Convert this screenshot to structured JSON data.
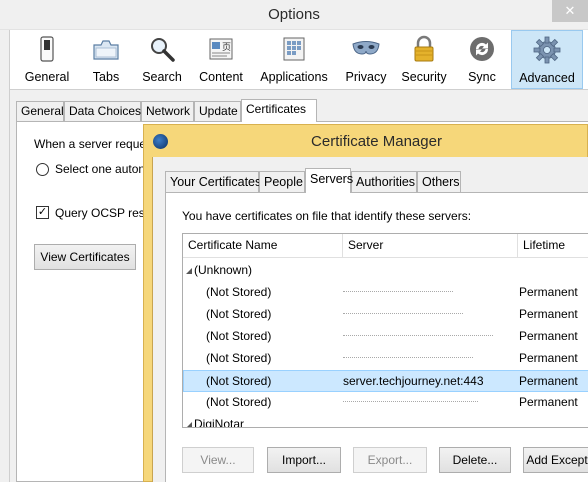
{
  "options_window": {
    "title": "Options",
    "close_symbol": "✕",
    "toolbar": [
      {
        "label": "General",
        "icon": "switch-icon"
      },
      {
        "label": "Tabs",
        "icon": "tabs-icon"
      },
      {
        "label": "Search",
        "icon": "magnifier-icon"
      },
      {
        "label": "Content",
        "icon": "content-icon"
      },
      {
        "label": "Applications",
        "icon": "applications-icon"
      },
      {
        "label": "Privacy",
        "icon": "mask-icon"
      },
      {
        "label": "Security",
        "icon": "padlock-icon"
      },
      {
        "label": "Sync",
        "icon": "sync-icon"
      },
      {
        "label": "Advanced",
        "icon": "gear-icon",
        "selected": true
      }
    ],
    "subtabs": [
      "General",
      "Data Choices",
      "Network",
      "Update",
      "Certificates"
    ],
    "active_subtab": "Certificates",
    "panel": {
      "server_request_text": "When a server reque",
      "radio_select_label": "Select one auton",
      "ocsp_label": "Query OCSP resp",
      "ocsp_checked": true,
      "view_certificates_button": "View Certificates"
    }
  },
  "certificate_manager": {
    "title": "Certificate Manager",
    "tabs": [
      "Your Certificates",
      "People",
      "Servers",
      "Authorities",
      "Others"
    ],
    "active_tab": "Servers",
    "description": "You have certificates on file that identify these servers:",
    "columns": [
      "Certificate Name",
      "Server",
      "Lifetime"
    ],
    "groups": [
      {
        "name": "(Unknown)",
        "expanded": true
      },
      {
        "name": "DigiNotar",
        "expanded": true
      }
    ],
    "rows": [
      {
        "name": "(Not Stored)",
        "server": "",
        "lifetime": "Permanent",
        "selected": false
      },
      {
        "name": "(Not Stored)",
        "server": "",
        "lifetime": "Permanent",
        "selected": false
      },
      {
        "name": "(Not Stored)",
        "server": "",
        "lifetime": "Permanent",
        "selected": false
      },
      {
        "name": "(Not Stored)",
        "server": "",
        "lifetime": "Permanent",
        "selected": false
      },
      {
        "name": "(Not Stored)",
        "server": "server.techjourney.net:443",
        "lifetime": "Permanent",
        "selected": true
      },
      {
        "name": "(Not Stored)",
        "server": "",
        "lifetime": "Permanent",
        "selected": false
      }
    ],
    "buttons": {
      "view": "View...",
      "import": "Import...",
      "export": "Export...",
      "delete": "Delete...",
      "add_exception": "Add Except"
    },
    "colors": {
      "title_bar": "#f6d77a",
      "selection": "#cce8ff"
    }
  }
}
